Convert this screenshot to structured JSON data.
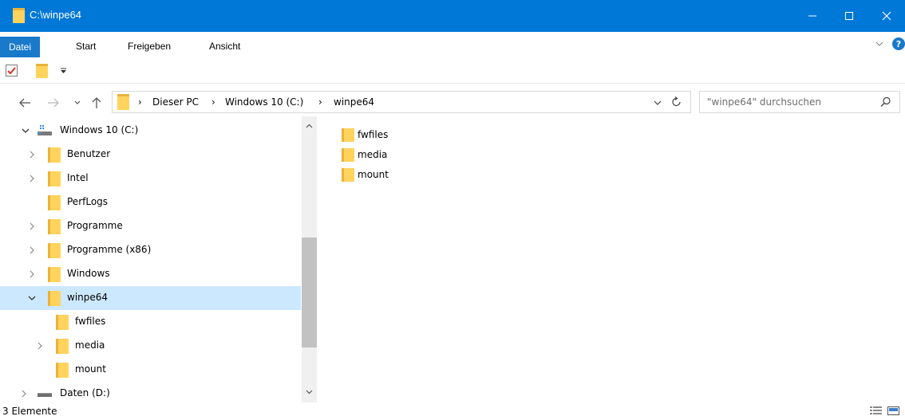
{
  "window": {
    "title": "C:\\winpe64",
    "accent_color": "#0078d7"
  },
  "ribbon": {
    "tabs": [
      {
        "label": "Datei"
      },
      {
        "label": "Start"
      },
      {
        "label": "Freigeben"
      },
      {
        "label": "Ansicht"
      }
    ]
  },
  "address": {
    "crumbs": [
      "Dieser PC",
      "Windows 10 (C:)",
      "winpe64"
    ]
  },
  "search": {
    "placeholder": "\"winpe64\" durchsuchen"
  },
  "tree": {
    "items": [
      {
        "label": "Windows 10 (C:)",
        "expanded": true,
        "icon": "drive-icon"
      },
      {
        "label": "Benutzer",
        "expandable": true,
        "icon": "folder-icon"
      },
      {
        "label": "Intel",
        "expandable": true,
        "icon": "folder-icon"
      },
      {
        "label": "PerfLogs",
        "expandable": false,
        "icon": "folder-icon"
      },
      {
        "label": "Programme",
        "expandable": true,
        "icon": "folder-icon"
      },
      {
        "label": "Programme (x86)",
        "expandable": true,
        "icon": "folder-icon"
      },
      {
        "label": "Windows",
        "expandable": true,
        "icon": "folder-icon"
      },
      {
        "label": "winpe64",
        "expanded": true,
        "selected": true,
        "icon": "folder-icon"
      },
      {
        "label": "fwfiles",
        "expandable": false,
        "icon": "folder-icon"
      },
      {
        "label": "media",
        "expandable": true,
        "icon": "folder-icon"
      },
      {
        "label": "mount",
        "expandable": false,
        "icon": "folder-icon"
      },
      {
        "label": "Daten (D:)",
        "expandable": true,
        "icon": "drive-icon"
      }
    ]
  },
  "content": {
    "items": [
      {
        "label": "fwfiles",
        "icon": "folder-icon"
      },
      {
        "label": "media",
        "icon": "folder-icon"
      },
      {
        "label": "mount",
        "icon": "folder-icon"
      }
    ]
  },
  "status": {
    "count_text": "3 Elemente"
  }
}
